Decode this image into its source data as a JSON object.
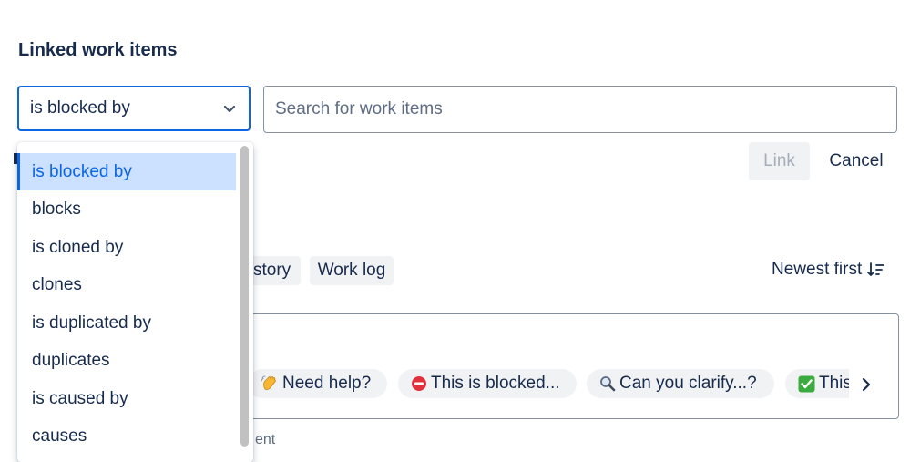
{
  "section": {
    "title": "Linked work items"
  },
  "link_type": {
    "selected": "is blocked by",
    "options": [
      "is blocked by",
      "blocks",
      "is cloned by",
      "clones",
      "is duplicated by",
      "duplicates",
      "is caused by",
      "causes"
    ]
  },
  "search": {
    "placeholder": "Search for work items",
    "value": ""
  },
  "actions": {
    "link_label": "Link",
    "cancel_label": "Cancel"
  },
  "activity": {
    "tabs": [
      {
        "label": "story"
      },
      {
        "label": "Work log"
      }
    ],
    "sort_label": "Newest first"
  },
  "comment": {
    "quick_replies": [
      {
        "label": "Need help?",
        "icon": "waving-hand-icon"
      },
      {
        "label": "This is blocked...",
        "icon": "no-entry-icon"
      },
      {
        "label": "Can you clarify...?",
        "icon": "magnifier-icon"
      },
      {
        "label": "This",
        "icon": "check-mark-icon"
      }
    ],
    "hint_fragment": "ent"
  },
  "colors": {
    "accent": "#0c66e4",
    "selected_bg": "#cce0ff",
    "text": "#172b4d",
    "subtle": "#5e6c84",
    "disabled": "#a5adba"
  }
}
